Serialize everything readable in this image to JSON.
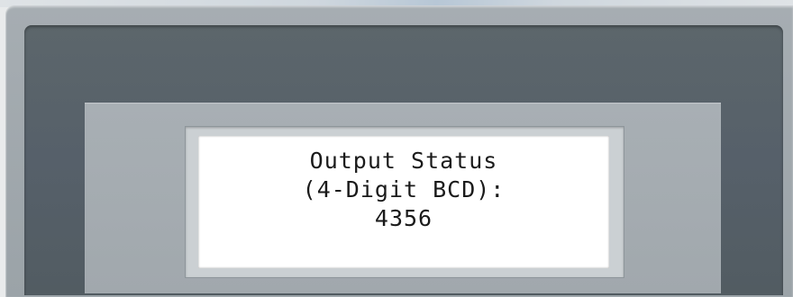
{
  "display": {
    "lines": [
      "Output Status",
      "(4-Digit BCD):",
      "4356"
    ]
  },
  "colors": {
    "outer_panel": "#9ba3a8",
    "bezel": "#56606a",
    "inner_frame": "#a1a8ad",
    "lcd_background": "#ffffff",
    "lcd_text": "#1a1a1a"
  }
}
